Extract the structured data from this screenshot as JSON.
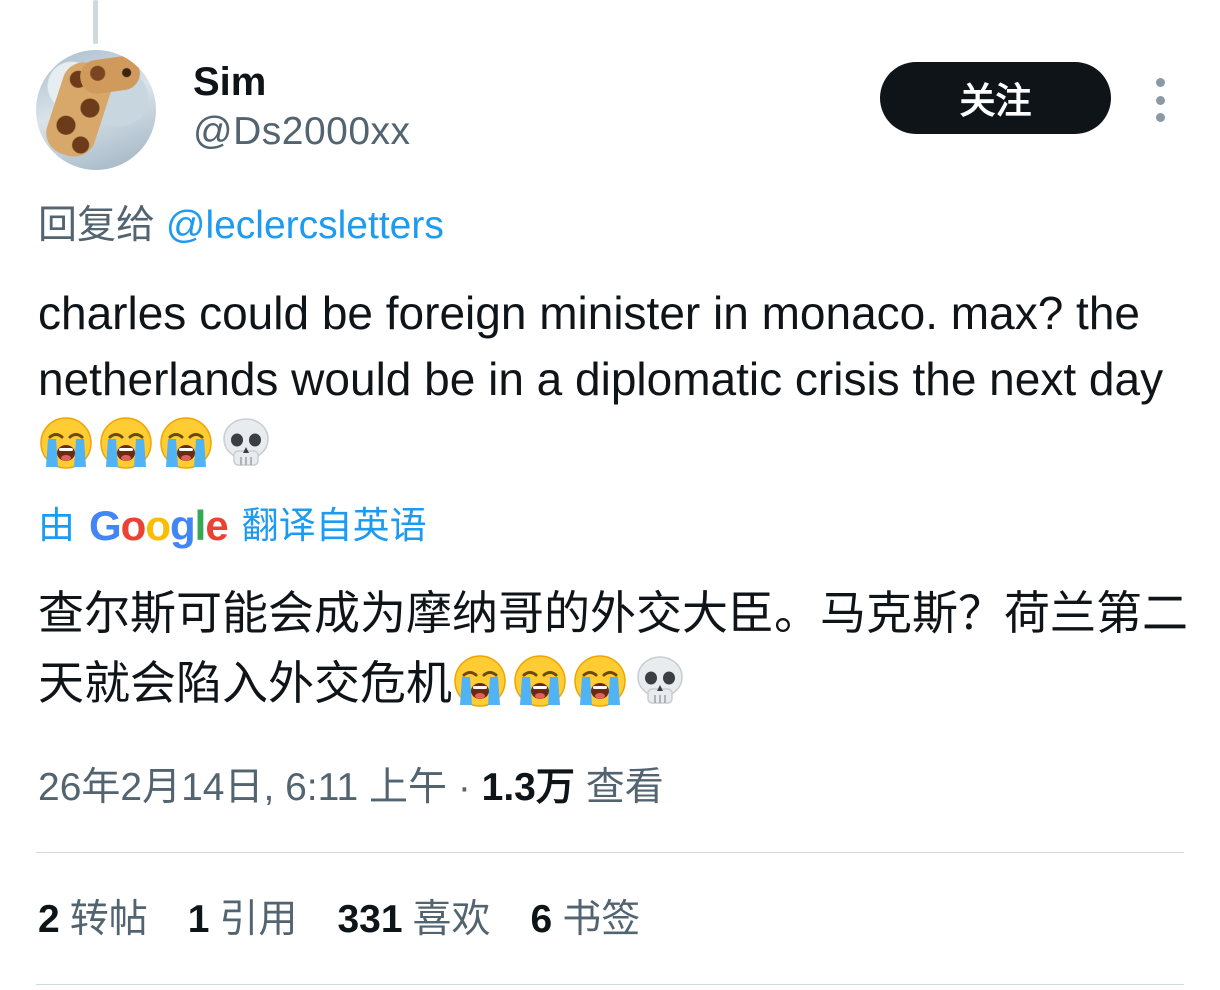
{
  "author": {
    "display_name": "Sim",
    "handle": "@Ds2000xx"
  },
  "follow_label": "关注",
  "reply_to": {
    "prefix": "回复给",
    "mention": "@leclercsletters"
  },
  "tweet": {
    "text": "charles could be foreign minister in monaco. max? the netherlands would be in a diplomatic crisis the next day",
    "emojis": [
      "loudly-crying-face",
      "loudly-crying-face",
      "loudly-crying-face",
      "skull"
    ]
  },
  "translation": {
    "prefix": "由",
    "provider_letters": [
      "G",
      "o",
      "o",
      "g",
      "l",
      "e"
    ],
    "suffix": "翻译自英语",
    "text": "查尔斯可能会成为摩纳哥的外交大臣。马克斯？荷兰第二天就会陷入外交危机"
  },
  "meta": {
    "timestamp": "26年2月14日, 6:11 上午",
    "separator": "·",
    "views_count": "1.3万",
    "views_label": "查看"
  },
  "stats": [
    {
      "count": "2",
      "label": "转帖"
    },
    {
      "count": "1",
      "label": "引用"
    },
    {
      "count": "331",
      "label": "喜欢"
    },
    {
      "count": "6",
      "label": "书签"
    }
  ],
  "colors": {
    "accent": "#1d9bf0",
    "secondary_text": "#536471",
    "follow_button_bg": "#0f1419"
  }
}
